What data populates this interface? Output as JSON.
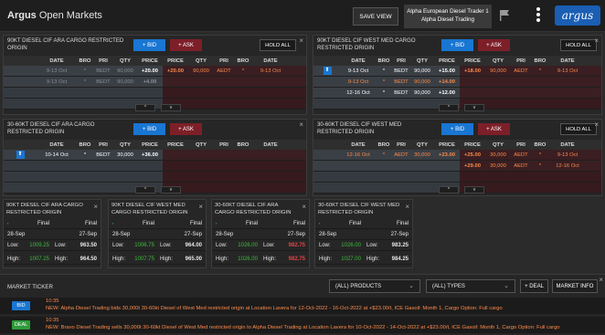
{
  "header": {
    "brand_bold": "Argus",
    "brand_rest": "Open Markets",
    "save_view": "SAVE VIEW",
    "user_line1": "Alpha European Diesel Trader 1",
    "user_line2": "Alpha Diesel Trading",
    "logo": "argus"
  },
  "labels": {
    "bid": "+ BID",
    "ask": "+ ASK",
    "hold_all": "HOLD ALL",
    "final": "Final",
    "low": "Low:",
    "high": "High:",
    "up": "^",
    "down": "v"
  },
  "columns": [
    "DATE",
    "BRO",
    "PRI",
    "QTY",
    "PRICE",
    "PRICE",
    "QTY",
    "PRI",
    "BRO",
    "DATE"
  ],
  "panels": {
    "p1": {
      "title": "90KT DIESEL CIF ARA CARGO RESTRICTED ORIGIN",
      "rows": [
        {
          "bdate": "9-13 Oct",
          "bbro": "*",
          "bpri": "BEDT",
          "bqty": "90,000",
          "bprice": "+20.00",
          "aprice": "+20.00",
          "aqty": "90,000",
          "apri": "AEDT",
          "abro": "*",
          "adate": "9-13 Oct"
        },
        {
          "bdate": "9-13 Oct",
          "bbro": "*",
          "bpri": "BEDT",
          "bqty": "90,000",
          "bprice": "+4.00",
          "aprice": "",
          "aqty": "",
          "apri": "",
          "abro": "",
          "adate": ""
        }
      ]
    },
    "p2": {
      "title": "90KT DIESEL CIF WEST MED CARGO RESTRICTED ORIGIN",
      "rows": [
        {
          "bdate": "9-13 Oct",
          "bbro": "*",
          "bpri": "BEDT",
          "bqty": "90,000",
          "bprice": "+15.00",
          "aprice": "+18.00",
          "aqty": "90,000",
          "apri": "AEDT",
          "abro": "*",
          "adate": "9-13 Oct"
        },
        {
          "bdate": "9-13 Oct",
          "bbro": "*",
          "bpri": "BEDT",
          "bqty": "90,000",
          "bprice": "+14.00",
          "aprice": "",
          "aqty": "",
          "apri": "",
          "abro": "",
          "adate": ""
        },
        {
          "bdate": "12-16 Oct",
          "bbro": "*",
          "bpri": "BEDT",
          "bqty": "90,000",
          "bprice": "+12.00",
          "aprice": "",
          "aqty": "",
          "apri": "",
          "abro": "",
          "adate": ""
        }
      ]
    },
    "p3": {
      "title": "30-60KT DIESEL CIF ARA CARGO RESTRICTED ORIGIN",
      "rows": [
        {
          "bdate": "10-14 Oct",
          "bbro": "*",
          "bpri": "BEDT",
          "bqty": "30,000",
          "bprice": "+36.00",
          "aprice": "",
          "aqty": "",
          "apri": "",
          "abro": "",
          "adate": ""
        }
      ]
    },
    "p4": {
      "title": "30-60KT DIESEL CIF WEST MED RESTRICTED ORIGIN",
      "rows": [
        {
          "bdate": "12-16 Oct",
          "bbro": "*",
          "bpri": "AEDT",
          "bqty": "30,000",
          "bprice": "+23.00",
          "aprice": "+25.00",
          "aqty": "30,000",
          "apri": "AEDT",
          "abro": "*",
          "adate": "9-13 Oct"
        },
        {
          "bdate": "",
          "bbro": "",
          "bpri": "",
          "bqty": "",
          "bprice": "",
          "aprice": "+29.00",
          "aqty": "30,000",
          "apri": "AEDT",
          "abro": "*",
          "adate": "12-16 Oct"
        }
      ]
    }
  },
  "cards": [
    {
      "title": "90KT DIESEL CIF ARA CARGO RESTRICTED ORIGIN",
      "d1": "28-Sep",
      "d2": "27-Sep",
      "low1": "1009.25",
      "low2": "963.50",
      "high1": "1007.25",
      "high2": "964.50"
    },
    {
      "title": "90KT DIESEL CIF WEST MED CARGO RESTRICTED ORIGIN",
      "d1": "28-Sep",
      "d2": "27-Sep",
      "low1": "1006.75",
      "low2": "964.00",
      "high1": "1007.75",
      "high2": "965.00"
    },
    {
      "title": "30-60KT DIESEL CIF ARA CARGO RESTRICTED ORIGIN",
      "d1": "28-Sep",
      "d2": "27-Sep",
      "low1": "1026.00",
      "low2": "982.75",
      "high1": "1026.00",
      "high2": "982.75"
    },
    {
      "title": "30-60KT DIESEL CIF WEST MED RESTRICTED ORIGIN",
      "d1": "28-Sep",
      "d2": "27-Sep",
      "low1": "1026.00",
      "low2": "983.25",
      "high1": "1027.00",
      "high2": "984.25"
    }
  ],
  "ticker": {
    "title": "MARKET TICKER",
    "products": "(ALL) PRODUCTS",
    "types": "(ALL) TYPES",
    "deal_btn": "+ DEAL",
    "market_info": "MARKET INFO",
    "items": [
      {
        "badge": "BID",
        "time": "10:35",
        "text": "NEW: Alpha Diesel Trading bids 30,000t 30-60kt Diesel of West Med restricted origin at Location Lavera for 12-Oct-2022 - 16-Oct-2022 at +$23.00/t, ICE Gasoil: Month 1, Cargo Option: Full cargo"
      },
      {
        "badge": "DEAL",
        "time": "10:35",
        "text": "NEW: Bravo Diesel Trading sells 30,000t 30-60kt Diesel of West Med restricted origin to Alpha Diesel Trading at Location Lavera for 10-Oct-2022 - 14-Oct-2022 at +$23.00/t, ICE Gasoil: Month 1, Cargo Option: Full cargo"
      }
    ]
  },
  "colors": {
    "bid_blue": "#1976d2",
    "ask_red": "#7d1f28",
    "accent_orange": "#ff8b4a",
    "low_green": "#3dbb3d",
    "high_red": "#e04444"
  }
}
